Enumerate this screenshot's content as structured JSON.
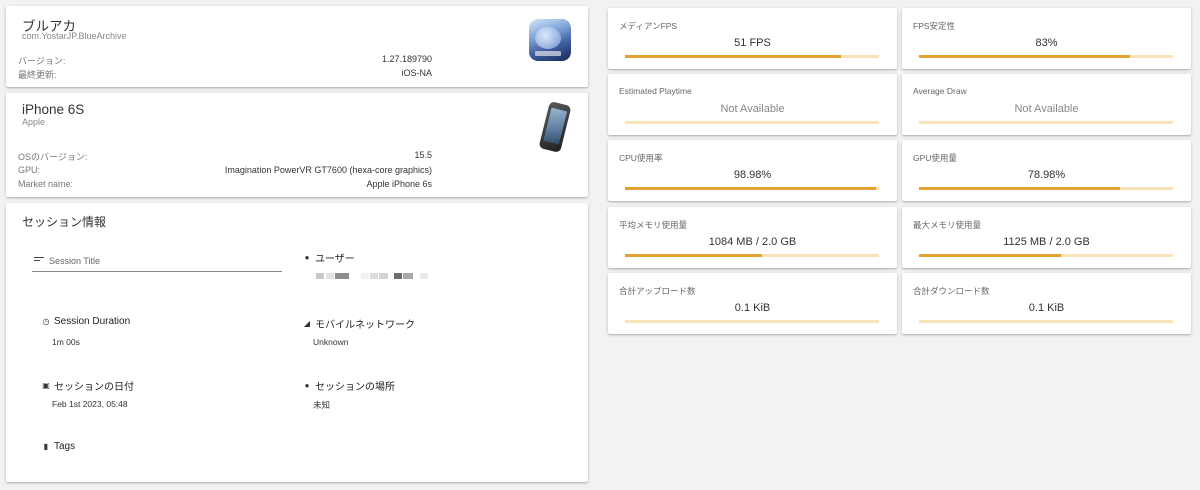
{
  "app": {
    "name": "ブルアカ",
    "package": "com.YostarJP.BlueArchive",
    "fields": [
      {
        "label": "バージョン:",
        "value": "1.27.189790"
      },
      {
        "label": "最終更新:",
        "value": "iOS-NA"
      }
    ],
    "icon": "blue-archive-app-icon"
  },
  "device": {
    "name": "iPhone 6S",
    "maker": "Apple",
    "fields": [
      {
        "label": "OSのバージョン:",
        "value": "15.5"
      },
      {
        "label": "GPU:",
        "value": "Imagination PowerVR GT7600 (hexa-core graphics)"
      },
      {
        "label": "Market name:",
        "value": "Apple iPhone 6s"
      }
    ],
    "icon": "iphone-device-image"
  },
  "session": {
    "title": "セッション情報",
    "title_placeholder": "Session Title",
    "user_label": "ユーザー",
    "duration_label": "Session Duration",
    "duration_value": "1m 00s",
    "network_label": "モバイルネットワーク",
    "network_value": "Unknown",
    "date_label": "セッションの日付",
    "date_value": "Feb 1st 2023, 05:48",
    "location_label": "セッションの場所",
    "location_value": "未知",
    "tags_label": "Tags"
  },
  "metrics": [
    {
      "label": "メディアンFPS",
      "value": "51 FPS",
      "progress": 0.85
    },
    {
      "label": "FPS安定性",
      "value": "83%",
      "progress": 0.83
    },
    {
      "label": "Estimated Playtime",
      "value": "Not Available",
      "progress": 0
    },
    {
      "label": "Average Draw",
      "value": "Not Available",
      "progress": 0
    },
    {
      "label": "CPU使用率",
      "value": "98.98%",
      "progress": 0.99
    },
    {
      "label": "GPU使用量",
      "value": "78.98%",
      "progress": 0.79
    },
    {
      "label": "平均メモリ使用量",
      "value": "1084 MB / 2.0 GB",
      "progress": 0.54
    },
    {
      "label": "最大メモリ使用量",
      "value": "1125 MB / 2.0 GB",
      "progress": 0.56
    },
    {
      "label": "合計アップロード数",
      "value": "0.1 KiB",
      "progress": 0
    },
    {
      "label": "合計ダウンロード数",
      "value": "0.1 KiB",
      "progress": 0
    }
  ],
  "colors": {
    "bar_fill": "#e5a232",
    "bar_track": "#f8e3b8",
    "background": "#f2f2f2"
  }
}
